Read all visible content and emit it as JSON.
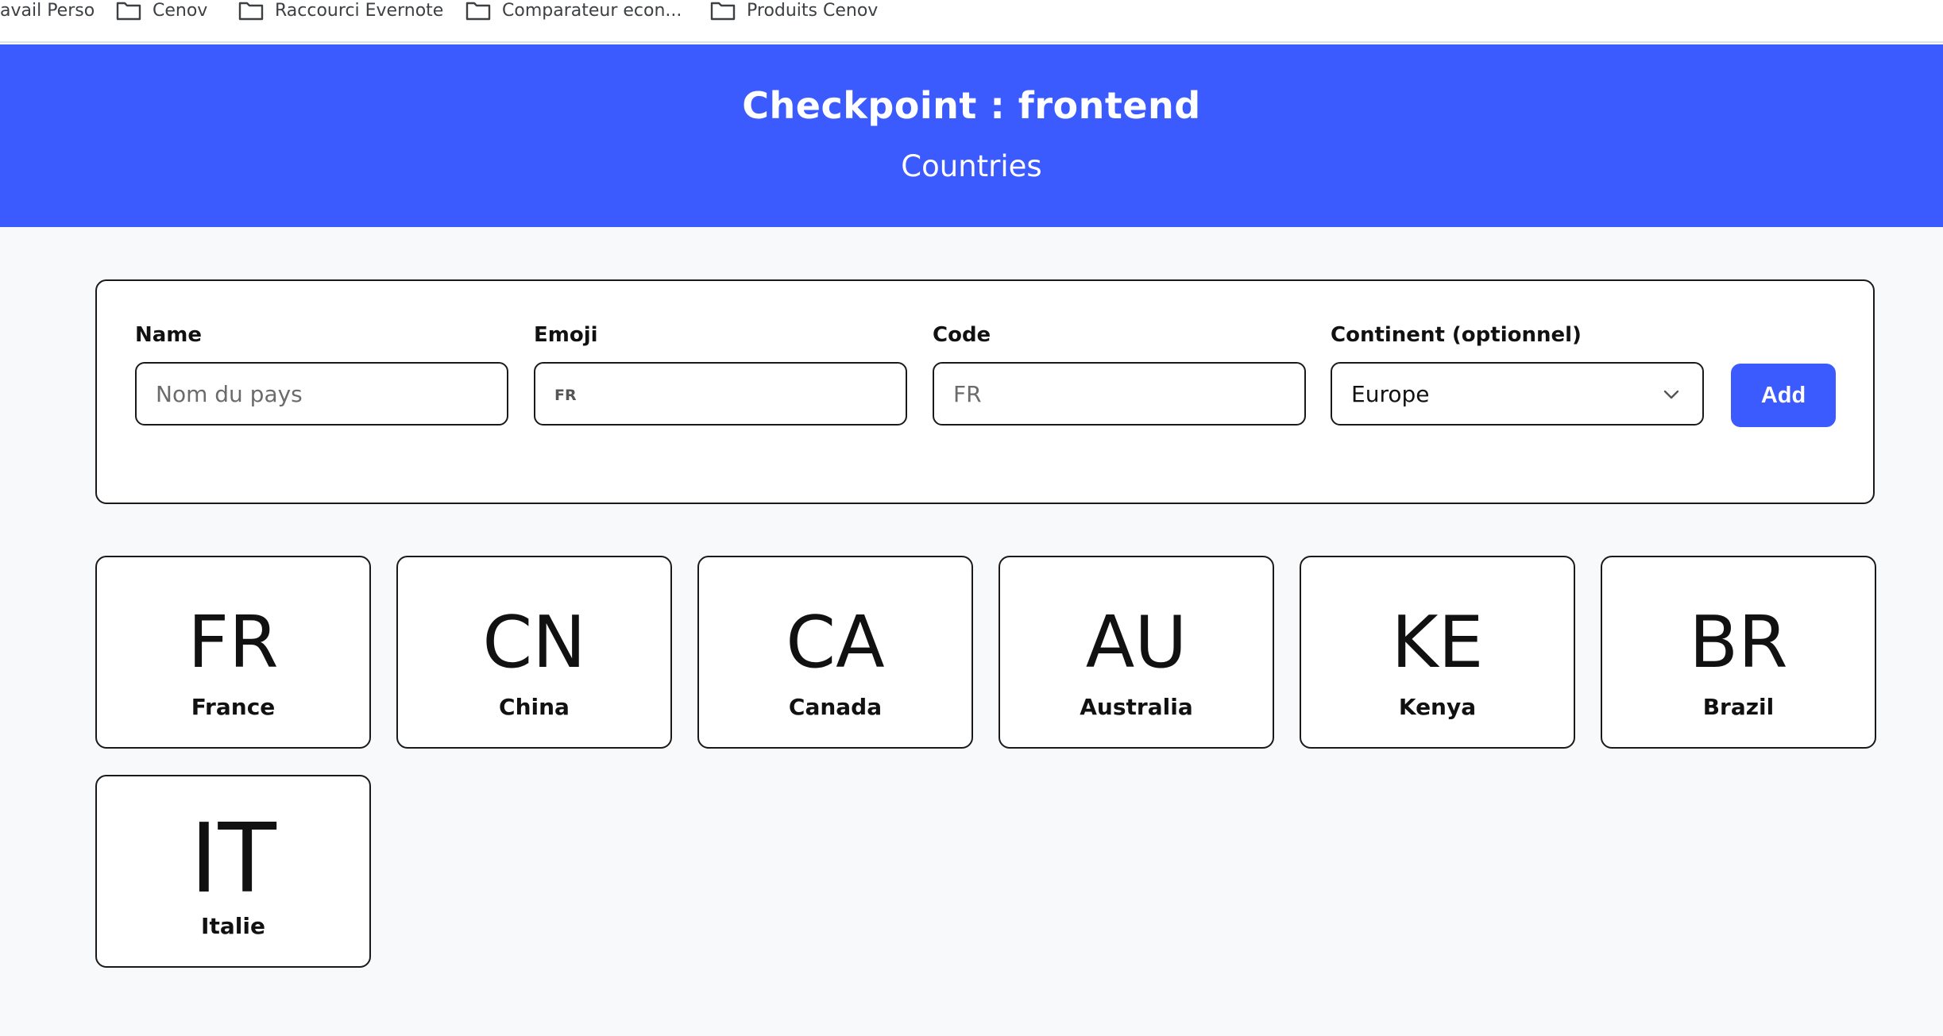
{
  "bookmarks": [
    {
      "label": "avail Perso",
      "icon": "none"
    },
    {
      "label": "Cenov",
      "icon": "folder-icon"
    },
    {
      "label": "Raccourci Evernote",
      "icon": "folder-icon"
    },
    {
      "label": "Comparateur econ...",
      "icon": "folder-icon"
    },
    {
      "label": "Produits Cenov",
      "icon": "folder-icon"
    }
  ],
  "header": {
    "title": "Checkpoint : frontend",
    "subtitle": "Countries"
  },
  "form": {
    "name_label": "Name",
    "name_placeholder": "Nom du pays",
    "emoji_label": "Emoji",
    "emoji_placeholder": "FR",
    "code_label": "Code",
    "code_placeholder": "FR",
    "continent_label": "Continent (optionnel)",
    "continent_value": "Europe",
    "add_label": "Add"
  },
  "countries": [
    {
      "code": "FR",
      "name": "France"
    },
    {
      "code": "CN",
      "name": "China"
    },
    {
      "code": "CA",
      "name": "Canada"
    },
    {
      "code": "AU",
      "name": "Australia"
    },
    {
      "code": "KE",
      "name": "Kenya"
    },
    {
      "code": "BR",
      "name": "Brazil"
    },
    {
      "code": "IT",
      "name": "Italie"
    }
  ],
  "colors": {
    "accent": "#3c5bff",
    "background": "#f8f9fb",
    "border": "#1a1a1a"
  }
}
